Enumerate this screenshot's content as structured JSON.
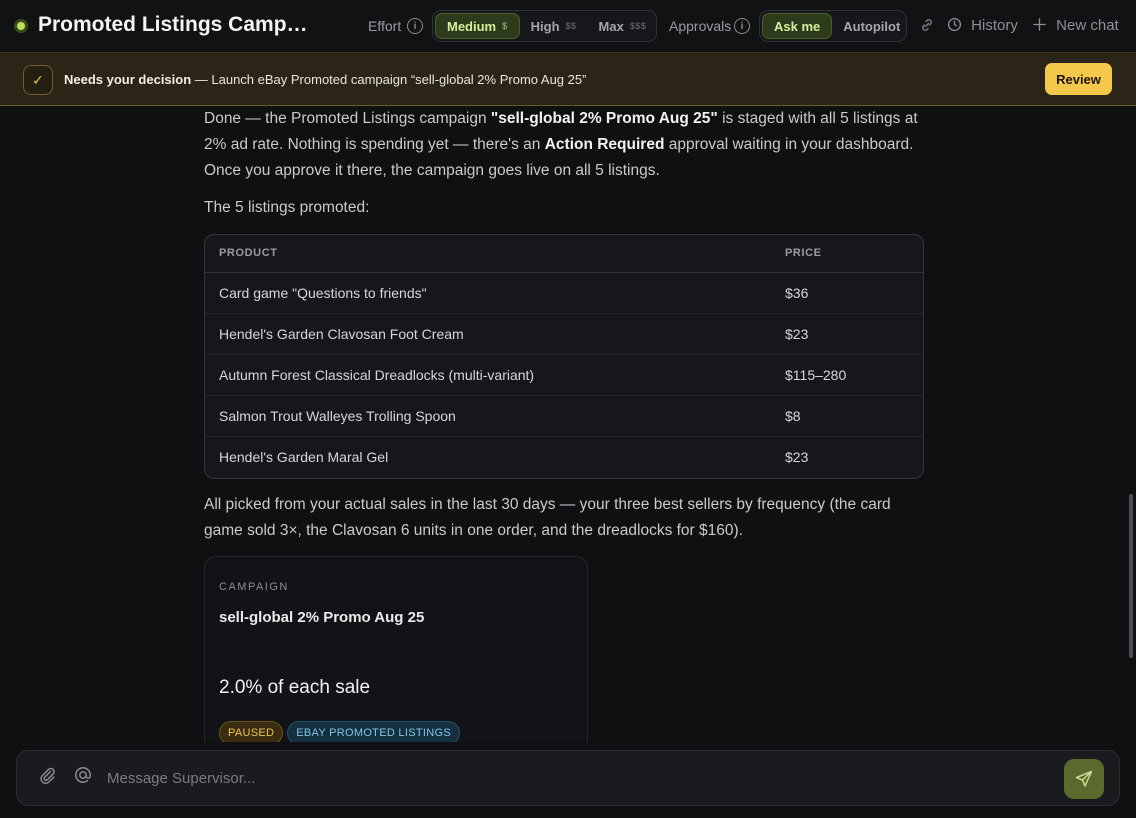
{
  "header": {
    "title": "Promoted Listings Campai...",
    "effort_label": "Effort",
    "effort_options": [
      {
        "label": "Medium",
        "cost": "$",
        "active": true
      },
      {
        "label": "High",
        "cost": "$$",
        "active": false
      },
      {
        "label": "Max",
        "cost": "$$$",
        "active": false
      }
    ],
    "approvals_label": "Approvals",
    "approval_options": [
      {
        "label": "Ask me",
        "active": true
      },
      {
        "label": "Autopilot",
        "active": false
      }
    ],
    "history_label": "History",
    "new_chat_label": "New chat",
    "icons": {
      "status": "status-dot",
      "info": "info-icon",
      "link": "link-icon",
      "history": "clock-icon",
      "new_chat": "plus-icon"
    }
  },
  "banner": {
    "bold": "Needs your decision",
    "text": " — Launch eBay Promoted campaign “sell-global 2% Promo Aug 25”",
    "review_label": "Review"
  },
  "message": {
    "p1_a": "Done — the Promoted Listings campaign ",
    "p1_b": "\"sell-global 2% Promo Aug 25\"",
    "p1_c": " is staged with all 5 listings at 2% ad rate. Nothing is spending yet — there's an ",
    "p1_d": "Action Required",
    "p1_e": " approval waiting in your dashboard. Once you approve it there, the campaign goes live on all 5 listings.",
    "p2": "The 5 listings promoted:",
    "p3": "All picked from your actual sales in the last 30 days — your three best sellers by frequency (the card game sold 3×, the Clavosan 6 units in one order, and the dreadlocks for $160)."
  },
  "table": {
    "headers": [
      "PRODUCT",
      "PRICE"
    ],
    "rows": [
      [
        "Card game \"Questions to friends\"",
        "$36"
      ],
      [
        "Hendel's Garden Clavosan Foot Cream",
        "$23"
      ],
      [
        "Autumn Forest Classical Dreadlocks (multi-variant)",
        "$115–280"
      ],
      [
        "Salmon Trout Walleyes Trolling Spoon",
        "$8"
      ],
      [
        "Hendel's Garden Maral Gel",
        "$23"
      ]
    ]
  },
  "card": {
    "kicker": "CAMPAIGN",
    "name": "sell-global 2% Promo Aug 25",
    "rate": "2.0% of each sale",
    "badges": [
      "PAUSED",
      "EBAY PROMOTED LISTINGS"
    ]
  },
  "composer": {
    "placeholder": "Message Supervisor...",
    "icons": {
      "attach": "paperclip-icon",
      "mention": "at-icon",
      "send": "send-icon"
    }
  },
  "colors": {
    "accent": "#b9e25a",
    "review": "#f4c84a",
    "paused": "#f0c552",
    "ebay": "#7fc6e6"
  }
}
